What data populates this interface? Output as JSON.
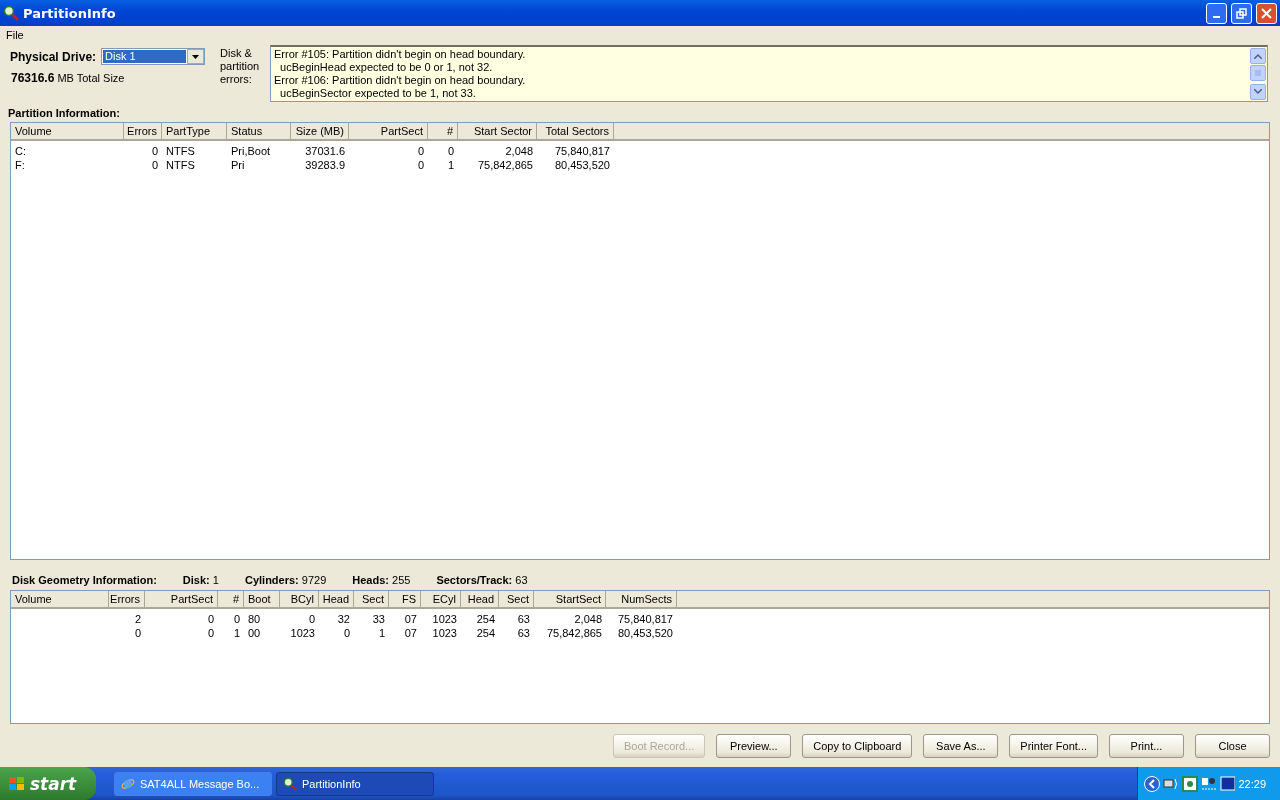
{
  "window": {
    "title": "PartitionInfo"
  },
  "menu": [
    "File"
  ],
  "drive": {
    "label": "Physical Drive:",
    "value": "Disk 1",
    "total_value": "76316.6",
    "total_unit": "MB Total Size"
  },
  "errors": {
    "label": "Disk & partition errors:",
    "lines": [
      "Error #105: Partition didn't begin on head boundary.",
      "  ucBeginHead expected to be 0 or 1, not 32.",
      "Error #106: Partition didn't begin on head boundary.",
      "  ucBeginSector expected to be 1, not 33."
    ]
  },
  "partition_info": {
    "label": "Partition Information:",
    "columns": [
      "Volume",
      "Errors",
      "PartType",
      "Status",
      "Size (MB)",
      "PartSect",
      "#",
      "Start Sector",
      "Total Sectors"
    ],
    "rows": [
      [
        "C:",
        "0",
        "NTFS",
        "Pri,Boot",
        "37031.6",
        "0",
        "0",
        "2,048",
        "75,840,817"
      ],
      [
        "F:",
        "0",
        "NTFS",
        "Pri",
        "39283.9",
        "0",
        "1",
        "75,842,865",
        "80,453,520"
      ]
    ]
  },
  "geometry": {
    "label": "Disk Geometry Information:",
    "facts": [
      {
        "label": "Disk:",
        "value": "1"
      },
      {
        "label": "Cylinders:",
        "value": "9729"
      },
      {
        "label": "Heads:",
        "value": "255"
      },
      {
        "label": "Sectors/Track:",
        "value": "63"
      }
    ],
    "columns": [
      "Volume",
      "Errors",
      "PartSect",
      "#",
      "Boot",
      "BCyl",
      "Head",
      "Sect",
      "FS",
      "ECyl",
      "Head",
      "Sect",
      "StartSect",
      "NumSects"
    ],
    "rows": [
      [
        "",
        "2",
        "0",
        "0",
        "80",
        "0",
        "32",
        "33",
        "07",
        "1023",
        "254",
        "63",
        "2,048",
        "75,840,817"
      ],
      [
        "",
        "0",
        "0",
        "1",
        "00",
        "1023",
        "0",
        "1",
        "07",
        "1023",
        "254",
        "63",
        "75,842,865",
        "80,453,520"
      ]
    ]
  },
  "buttons": [
    {
      "label": "Boot Record...",
      "disabled": true
    },
    {
      "label": "Preview...",
      "disabled": false
    },
    {
      "label": "Copy to Clipboard",
      "disabled": false
    },
    {
      "label": "Save As...",
      "disabled": false
    },
    {
      "label": "Printer Font...",
      "disabled": false
    },
    {
      "label": "Print...",
      "disabled": false
    },
    {
      "label": "Close",
      "disabled": false
    }
  ],
  "taskbar": {
    "start": "start",
    "tasks": [
      {
        "label": "SAT4ALL Message Bo...",
        "kind": "browser",
        "selected": false
      },
      {
        "label": "PartitionInfo",
        "kind": "app",
        "selected": true
      }
    ],
    "clock": "22:29"
  }
}
